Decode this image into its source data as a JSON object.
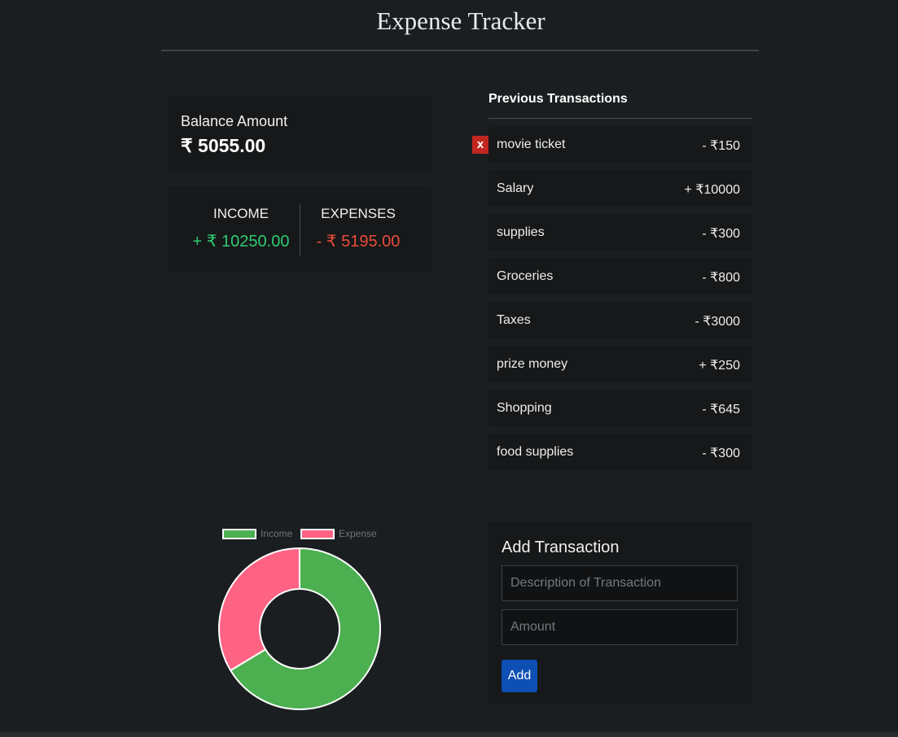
{
  "header": {
    "title": "Expense Tracker"
  },
  "balance": {
    "label": "Balance Amount",
    "value": "₹ 5055.00"
  },
  "summary": {
    "income_label": "INCOME",
    "income_value": "+ ₹ 10250.00",
    "expense_label": "EXPENSES",
    "expense_value": "- ₹ 5195.00"
  },
  "transactions": {
    "title": "Previous Transactions",
    "delete_label": "x",
    "items": [
      {
        "description": "movie ticket",
        "amount": "- ₹150",
        "type": "minus"
      },
      {
        "description": "Salary",
        "amount": "+ ₹10000",
        "type": "plus"
      },
      {
        "description": "supplies",
        "amount": "- ₹300",
        "type": "minus"
      },
      {
        "description": "Groceries",
        "amount": "- ₹800",
        "type": "minus"
      },
      {
        "description": "Taxes",
        "amount": "- ₹3000",
        "type": "minus"
      },
      {
        "description": "prize money",
        "amount": "+ ₹250",
        "type": "plus"
      },
      {
        "description": "Shopping",
        "amount": "- ₹645",
        "type": "minus"
      },
      {
        "description": "food supplies",
        "amount": "- ₹300",
        "type": "minus"
      }
    ]
  },
  "chart_data": {
    "type": "pie",
    "categories": [
      "Income",
      "Expense"
    ],
    "values": [
      10250,
      5195
    ],
    "colors": [
      "#4caf50",
      "#ff6384"
    ],
    "legend": "top"
  },
  "add_form": {
    "title": "Add Transaction",
    "description_placeholder": "Description of Transaction",
    "amount_placeholder": "Amount",
    "button_label": "Add"
  },
  "colors": {
    "background": "#1b1e20",
    "income": "#2ecc71",
    "expense": "#e74c3c",
    "button": "#0d4fb3"
  }
}
